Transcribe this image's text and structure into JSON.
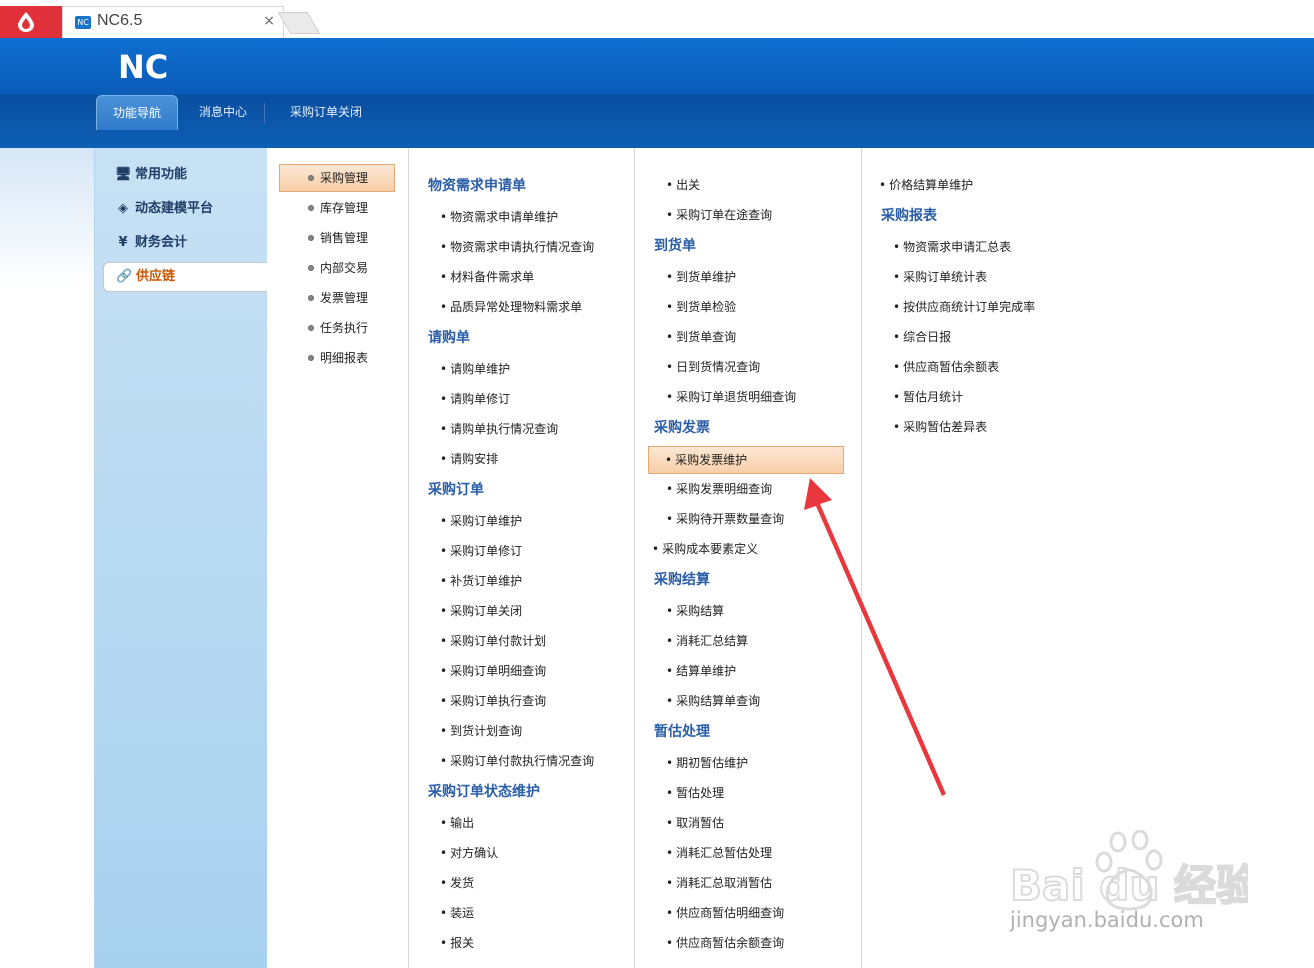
{
  "browser": {
    "tab_title": "NC6.5",
    "tab_close": "×",
    "favicon": "NC"
  },
  "header": {
    "logo_text": "NC"
  },
  "nav_tabs": [
    "功能导航",
    "消息中心",
    "采购订单关闭"
  ],
  "sidebar": {
    "items": [
      {
        "label": "常用功能",
        "icon": "monitor-icon"
      },
      {
        "label": "动态建模平台",
        "icon": "cube-icon"
      },
      {
        "label": "财务会计",
        "icon": "yen-icon"
      },
      {
        "label": "供应链",
        "icon": "link-icon"
      }
    ],
    "active_index": 3
  },
  "categories": {
    "items": [
      "采购管理",
      "库存管理",
      "销售管理",
      "内部交易",
      "发票管理",
      "任务执行",
      "明细报表"
    ],
    "active_index": 0
  },
  "col1": {
    "g1": {
      "title": "物资需求申请单",
      "items": [
        "物资需求申请单维护",
        "物资需求申请执行情况查询",
        "材料备件需求单",
        "品质异常处理物料需求单"
      ]
    },
    "g2": {
      "title": "请购单",
      "items": [
        "请购单维护",
        "请购单修订",
        "请购单执行情况查询",
        "请购安排"
      ]
    },
    "g3": {
      "title": "采购订单",
      "items": [
        "采购订单维护",
        "采购订单修订",
        "补货订单维护",
        "采购订单关闭",
        "采购订单付款计划",
        "采购订单明细查询",
        "采购订单执行查询",
        "到货计划查询",
        "采购订单付款执行情况查询"
      ]
    },
    "g4": {
      "title": "采购订单状态维护",
      "items": [
        "输出",
        "对方确认",
        "发货",
        "装运",
        "报关"
      ]
    }
  },
  "col2": {
    "top_items": [
      "出关",
      "采购订单在途查询"
    ],
    "g1": {
      "title": "到货单",
      "items": [
        "到货单维护",
        "到货单检验",
        "到货单查询",
        "日到货情况查询",
        "采购订单退货明细查询"
      ]
    },
    "g2": {
      "title": "采购发票",
      "items": [
        "采购发票维护",
        "采购发票明细查询",
        "采购待开票数量查询"
      ]
    },
    "standalone": "采购成本要素定义",
    "g3": {
      "title": "采购结算",
      "items": [
        "采购结算",
        "消耗汇总结算",
        "结算单维护",
        "采购结算单查询"
      ]
    },
    "g4": {
      "title": "暂估处理",
      "items": [
        "期初暂估维护",
        "暂估处理",
        "取消暂估",
        "消耗汇总暂估处理",
        "消耗汇总取消暂估",
        "供应商暂估明细查询",
        "供应商暂估余额查询"
      ]
    }
  },
  "col3": {
    "top_item": "价格结算单维护",
    "g1": {
      "title": "采购报表",
      "items": [
        "物资需求申请汇总表",
        "采购订单统计表",
        "按供应商统计订单完成率",
        "综合日报",
        "供应商暂估余额表",
        "暂估月统计",
        "采购暂估差异表"
      ]
    }
  },
  "highlight": "采购发票维护",
  "watermark": {
    "logo": "Bai du 经验",
    "url": "jingyan.baidu.com"
  },
  "colors": {
    "brand_blue": "#0b56b3",
    "heading_blue": "#2a5ea6",
    "active_orange": "#cc5500",
    "arrow_red": "#e8383d"
  }
}
